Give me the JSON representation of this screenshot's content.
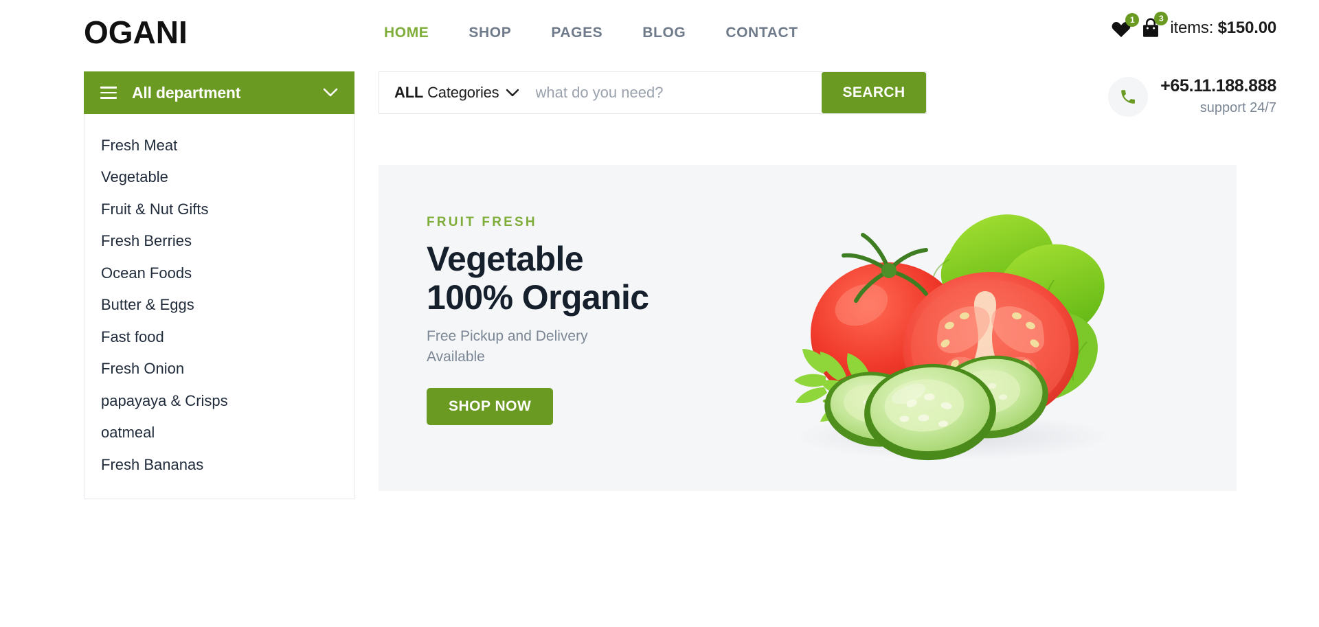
{
  "header": {
    "logo": "OGANI",
    "nav": [
      {
        "label": "HOME",
        "active": true
      },
      {
        "label": "SHOP",
        "active": false
      },
      {
        "label": "PAGES",
        "active": false
      },
      {
        "label": "BLOG",
        "active": false
      },
      {
        "label": "CONTACT",
        "active": false
      }
    ],
    "wishlist_badge": "1",
    "cart_badge": "3",
    "cart_label": "items:",
    "cart_total": "$150.00",
    "wishlist_icon": "heart-icon",
    "cart_icon": "shopping-bag-icon"
  },
  "support": {
    "phone_icon": "phone-icon",
    "number": "+65.11.188.888",
    "note": "support 24/7"
  },
  "department": {
    "menu_icon": "hamburger-icon",
    "title": "All department",
    "chevron_icon": "chevron-down-icon",
    "items": [
      "Fresh Meat",
      "Vegetable",
      "Fruit & Nut Gifts",
      "Fresh Berries",
      "Ocean Foods",
      "Butter & Eggs",
      "Fast food",
      "Fresh Onion",
      "papayaya & Crisps",
      "oatmeal",
      "Fresh Bananas"
    ]
  },
  "search": {
    "category_all": "ALL",
    "category_word": "Categories",
    "chevron_icon": "chevron-down-icon",
    "placeholder": "what do you need?",
    "value": "",
    "button_label": "SEARCH"
  },
  "hero": {
    "eyebrow": "FRUIT FRESH",
    "title_line1": "Vegetable",
    "title_line2": "100% Organic",
    "subtitle": "Free Pickup and Delivery Available",
    "button_label": "SHOP NOW",
    "image_alt": "tomatoes-cucumber-lettuce-image"
  },
  "colors": {
    "brand_green": "#6a9a22",
    "accent_green": "#7fad39",
    "nav_gray": "#6f7b8a",
    "hero_bg": "#f5f6f8",
    "text_dark": "#16202c"
  }
}
